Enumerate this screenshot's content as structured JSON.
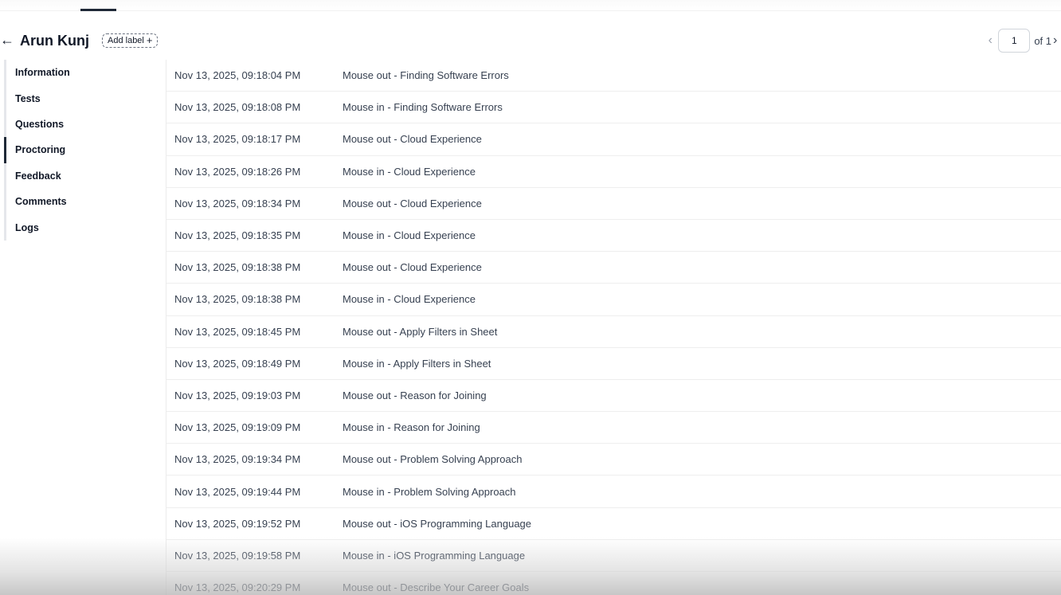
{
  "header": {
    "back_icon": "arrow-left-icon",
    "candidate_name": "Arun Kunj",
    "add_label": "Add label",
    "add_label_icon": "+"
  },
  "pagination": {
    "prev_icon": "chevron-left-icon",
    "current_page": "1",
    "of_text": "of 1",
    "next_icon": "chevron-right-icon"
  },
  "sidebar": {
    "items": [
      {
        "label": "Information"
      },
      {
        "label": "Tests"
      },
      {
        "label": "Questions"
      },
      {
        "label": "Proctoring",
        "active": true
      },
      {
        "label": "Feedback"
      },
      {
        "label": "Comments"
      },
      {
        "label": "Logs"
      }
    ]
  },
  "logs": [
    {
      "time": "Nov 13, 2025, 09:18:04 PM",
      "event": "Mouse out - Finding Software Errors"
    },
    {
      "time": "Nov 13, 2025, 09:18:08 PM",
      "event": "Mouse in - Finding Software Errors"
    },
    {
      "time": "Nov 13, 2025, 09:18:17 PM",
      "event": "Mouse out - Cloud Experience"
    },
    {
      "time": "Nov 13, 2025, 09:18:26 PM",
      "event": "Mouse in - Cloud Experience"
    },
    {
      "time": "Nov 13, 2025, 09:18:34 PM",
      "event": "Mouse out - Cloud Experience"
    },
    {
      "time": "Nov 13, 2025, 09:18:35 PM",
      "event": "Mouse in - Cloud Experience"
    },
    {
      "time": "Nov 13, 2025, 09:18:38 PM",
      "event": "Mouse out - Cloud Experience"
    },
    {
      "time": "Nov 13, 2025, 09:18:38 PM",
      "event": "Mouse in - Cloud Experience"
    },
    {
      "time": "Nov 13, 2025, 09:18:45 PM",
      "event": "Mouse out - Apply Filters in Sheet"
    },
    {
      "time": "Nov 13, 2025, 09:18:49 PM",
      "event": "Mouse in - Apply Filters in Sheet"
    },
    {
      "time": "Nov 13, 2025, 09:19:03 PM",
      "event": "Mouse out - Reason for Joining"
    },
    {
      "time": "Nov 13, 2025, 09:19:09 PM",
      "event": "Mouse in - Reason for Joining"
    },
    {
      "time": "Nov 13, 2025, 09:19:34 PM",
      "event": "Mouse out - Problem Solving Approach"
    },
    {
      "time": "Nov 13, 2025, 09:19:44 PM",
      "event": "Mouse in - Problem Solving Approach"
    },
    {
      "time": "Nov 13, 2025, 09:19:52 PM",
      "event": "Mouse out - iOS Programming Language"
    },
    {
      "time": "Nov 13, 2025, 09:19:58 PM",
      "event": "Mouse in - iOS Programming Language"
    },
    {
      "time": "Nov 13, 2025, 09:20:29 PM",
      "event": "Mouse out - Describe Your Career Goals"
    }
  ]
}
